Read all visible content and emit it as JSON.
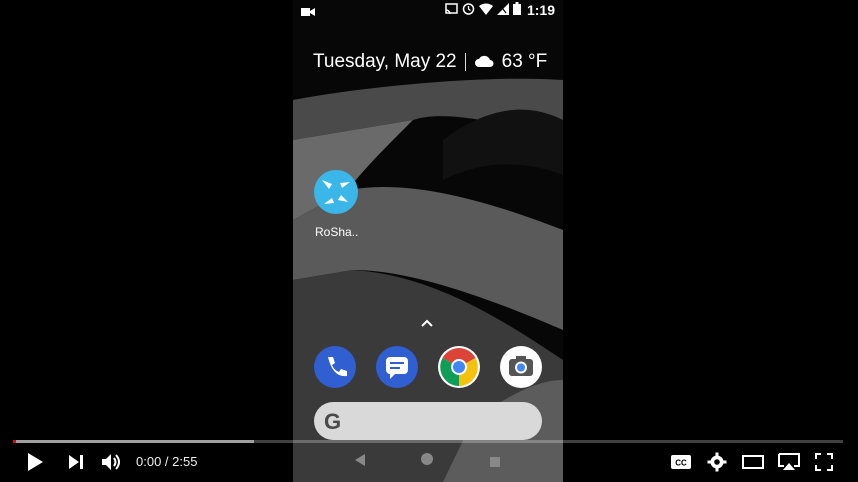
{
  "status": {
    "time": "1:19"
  },
  "home": {
    "date": "Tuesday, May 22",
    "weather": "63 °F"
  },
  "app": {
    "label": "RoSha.."
  },
  "player": {
    "time_display": "0:00 / 2:55",
    "played_fraction": 0.0,
    "buffered_fraction": 0.29
  },
  "icons": {
    "status_left": "video-camera-icon",
    "status_right": [
      "cast-icon",
      "alarm-icon",
      "wifi-icon",
      "signal-icon",
      "battery-icon"
    ],
    "dock": [
      "phone-icon",
      "messages-icon",
      "chrome-icon",
      "camera-icon"
    ]
  },
  "colors": {
    "accent": "#ff0000",
    "app_icon": "#3ab6e8",
    "dock_blue": "#2f5fd1"
  }
}
